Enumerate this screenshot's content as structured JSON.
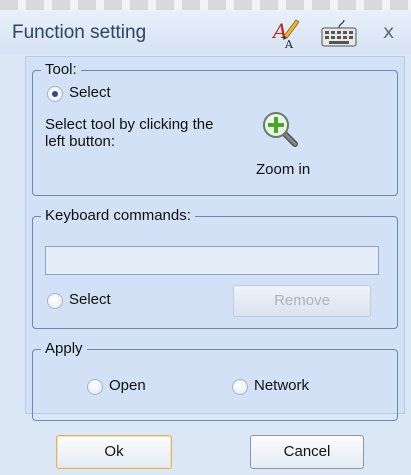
{
  "window": {
    "title": "Function setting",
    "close_glyph": "x"
  },
  "tool_group": {
    "legend": "Tool:",
    "radio_label": "Select",
    "radio_checked": true,
    "description": "Select tool by clicking the left button:",
    "zoom_label": "Zoom in",
    "zoom_icon": "zoom-in-magnifier-icon"
  },
  "keyboard_group": {
    "legend": "Keyboard commands:",
    "command_value": "",
    "radio_label": "Select",
    "radio_checked": false,
    "remove_label": "Remove",
    "remove_enabled": false
  },
  "apply_group": {
    "legend": "Apply",
    "options": [
      {
        "label": "Open",
        "checked": false
      },
      {
        "label": "Network",
        "checked": false
      }
    ]
  },
  "buttons": {
    "ok_label": "Ok",
    "cancel_label": "Cancel"
  },
  "colors": {
    "dialog_bg": "#dce7f6",
    "panel_bg": "#d2e1f5",
    "title_text": "#2d4560",
    "zoom_icon_green": "#4aa52e",
    "ok_border_accent": "#d9b56a"
  }
}
